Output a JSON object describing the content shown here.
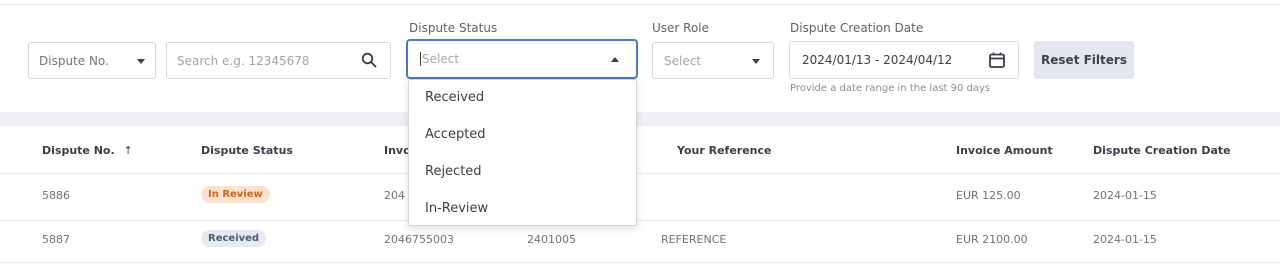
{
  "filters": {
    "dispute_no_select": "Dispute No.",
    "search_placeholder": "Search e.g. 12345678",
    "dispute_status_label": "Dispute Status",
    "dispute_status_placeholder": "Select",
    "user_role_label": "User Role",
    "user_role_placeholder": "Select",
    "creation_date_label": "Dispute Creation Date",
    "creation_date_value": "2024/01/13 - 2024/04/12",
    "date_hint": "Provide a date range in the last 90 days",
    "reset_button": "Reset Filters"
  },
  "status_options": [
    "Received",
    "Accepted",
    "Rejected",
    "In-Review"
  ],
  "table": {
    "headers": {
      "dispute_no": "Dispute No.",
      "sort_icon": "↑",
      "status": "Dispute Status",
      "invoice": "Invoi",
      "reference": "Your Reference",
      "amount": "Invoice Amount",
      "date": "Dispute Creation Date"
    },
    "rows": [
      {
        "dispute_no": "5886",
        "status": "In Review",
        "invoice": "204",
        "col4": "",
        "reference": "",
        "amount": "EUR 125.00",
        "date": "2024-01-15"
      },
      {
        "dispute_no": "5887",
        "status": "Received",
        "invoice": "2046755003",
        "col4": "2401005",
        "reference": "REFERENCE",
        "amount": "EUR 2100.00",
        "date": "2024-01-15"
      }
    ]
  },
  "colors": {
    "accent": "#4a78c8",
    "in_review_badge": "#fde1cf",
    "received_badge": "#e5e9f1"
  }
}
